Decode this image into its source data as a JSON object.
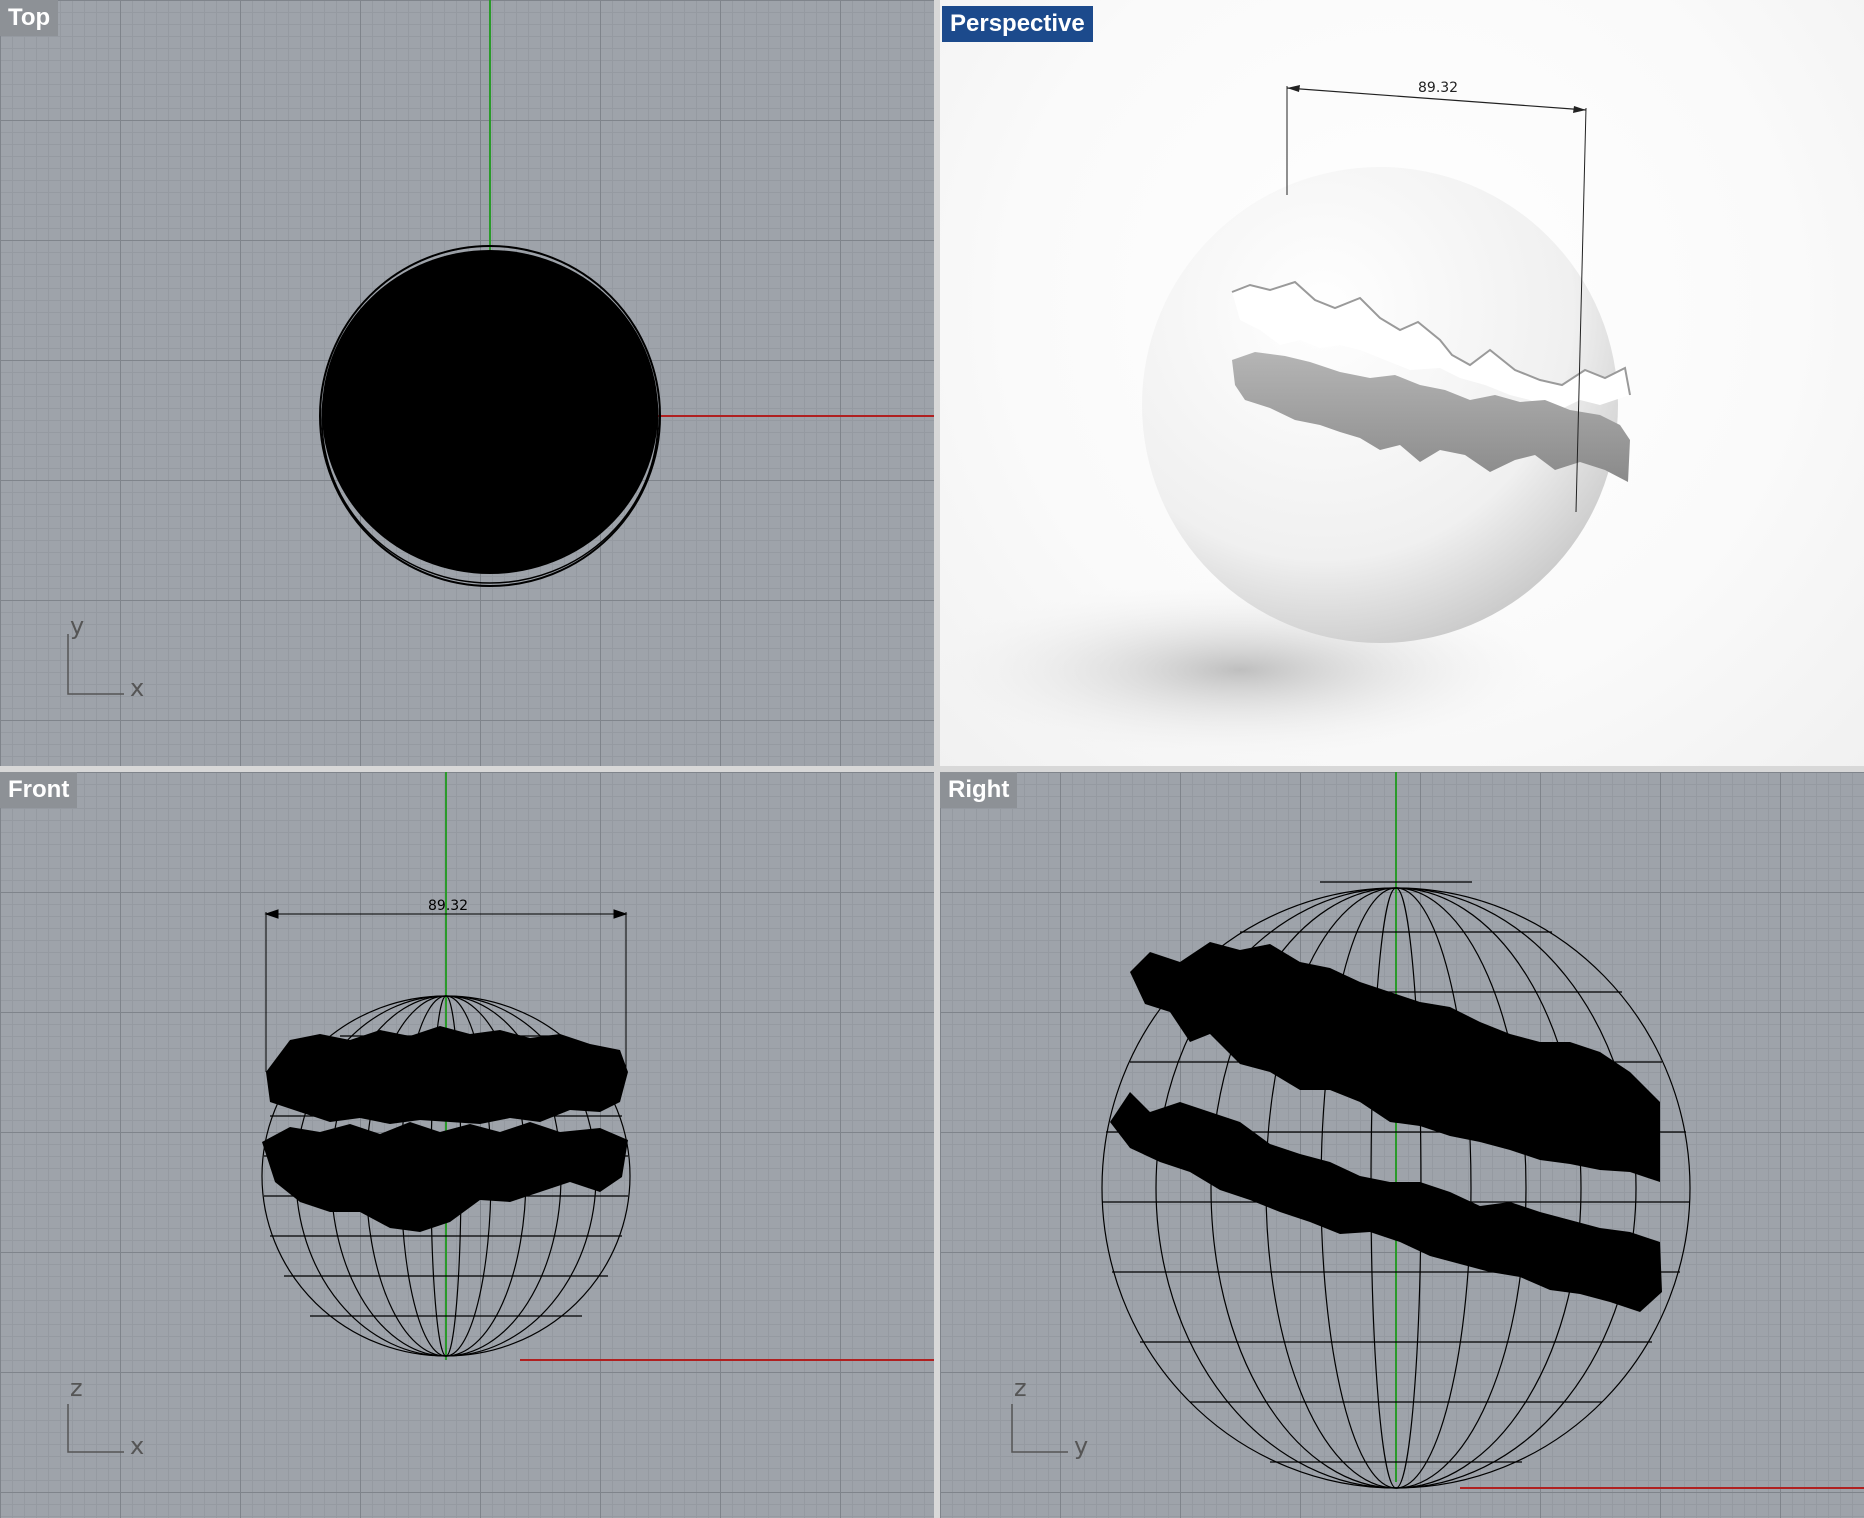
{
  "viewports": {
    "top": {
      "label": "Top",
      "axis_h": "x",
      "axis_v": "y"
    },
    "perspective": {
      "label": "Perspective",
      "dimension": "89.32"
    },
    "front": {
      "label": "Front",
      "axis_h": "x",
      "axis_v": "z",
      "dimension": "89.32"
    },
    "right": {
      "label": "Right",
      "axis_h": "y",
      "axis_v": "z"
    }
  },
  "colors": {
    "grid_bg": "#9ea3aa",
    "active_label": "#1c4a8c",
    "x_axis": "#b02020",
    "y_axis": "#2a9a2a"
  }
}
